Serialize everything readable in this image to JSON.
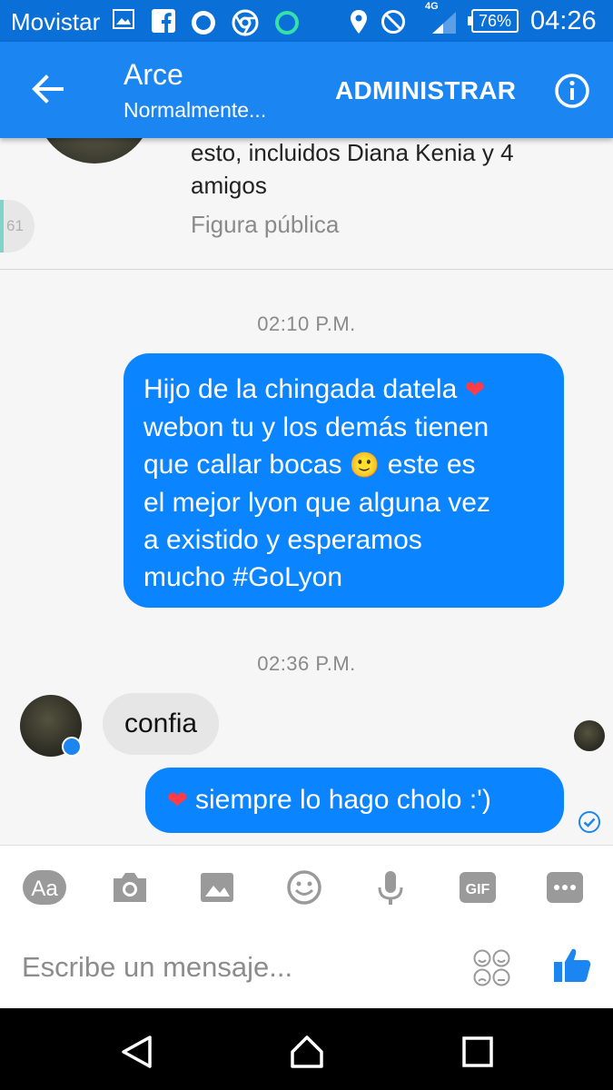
{
  "status_bar": {
    "carrier": "Movistar",
    "network": "4G",
    "battery": "76%",
    "time": "04:26"
  },
  "header": {
    "title": "Arce",
    "subtitle": "Normalmente...",
    "admin_label": "ADMINISTRAR"
  },
  "profile": {
    "stats_text": "esto, incluidos Diana Kenia y 4 amigos",
    "category": "Figura pública",
    "chathead_count": "61"
  },
  "messages": [
    {
      "timestamp": "02:10 P.M."
    },
    {
      "text": "Hijo de la chingada datela ❤️ webon tu y los demás tienen que callar bocas 🙂 este es el  mejor lyon que alguna vez a existido y esperamos mucho #GoLyon"
    },
    {
      "timestamp": "02:36 P.M."
    },
    {
      "text": "confia"
    },
    {
      "text": "❤️ siempre lo hago cholo :')"
    }
  ],
  "msg1_parts": {
    "line1": "Hijo de la chingada datela",
    "heart": "❤",
    "line2": "webon tu y los demás tienen",
    "line3a": "que callar bocas",
    "smile": "🙂",
    "line3b": "este es",
    "line4": "el  mejor lyon que alguna vez",
    "line5": "a existido y esperamos",
    "line6": "mucho #GoLyon"
  },
  "msg3_parts": {
    "heart": "❤",
    "text": "siempre lo hago cholo :')"
  },
  "composer": {
    "placeholder": "Escribe un mensaje...",
    "toolbar": [
      "Aa",
      "camera-icon",
      "image-icon",
      "emoji-icon",
      "microphone-icon",
      "GIF",
      "more-icon"
    ]
  },
  "colors": {
    "statusbar": "#0a6fd6",
    "appbar": "#1b86f2",
    "outgoing_bubble": "#0a84ff",
    "incoming_bubble": "#e6e6e6"
  }
}
